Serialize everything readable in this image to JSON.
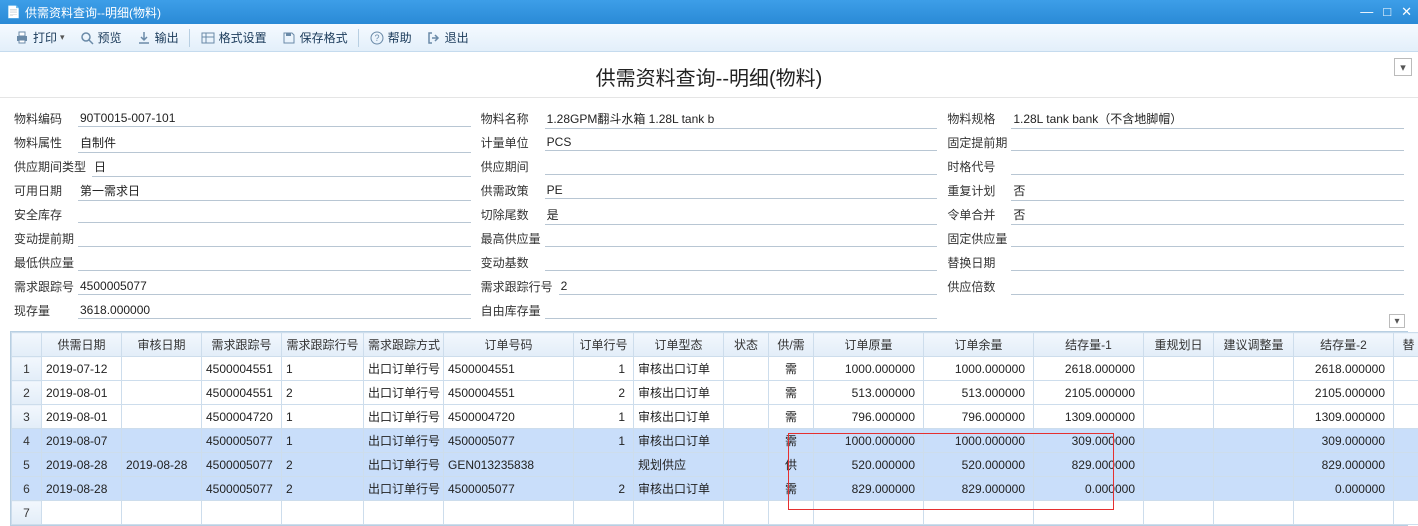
{
  "window": {
    "title": "供需资料查询--明细(物料)"
  },
  "toolbar": {
    "print": "打印",
    "preview": "预览",
    "export": "输出",
    "format": "格式设置",
    "save_format": "保存格式",
    "help": "帮助",
    "exit": "退出"
  },
  "page_title": "供需资料查询--明细(物料)",
  "form": {
    "r1": {
      "a_lbl": "物料编码",
      "a_val": "90T0015-007-101",
      "b_lbl": "物料名称",
      "b_val": "1.28GPM翻斗水箱 1.28L tank b",
      "c_lbl": "物料规格",
      "c_val": "1.28L tank bank（不含地脚帽）"
    },
    "r2": {
      "a_lbl": "物料属性",
      "a_val": "自制件",
      "b_lbl": "计量单位",
      "b_val": "PCS",
      "c_lbl": "固定提前期",
      "c_val": ""
    },
    "r3": {
      "a_lbl": "供应期间类型",
      "a_val": "日",
      "b_lbl": "供应期间",
      "b_val": "",
      "c_lbl": "时格代号",
      "c_val": ""
    },
    "r4": {
      "a_lbl": "可用日期",
      "a_val": "第一需求日",
      "b_lbl": "供需政策",
      "b_val": "PE",
      "c_lbl": "重复计划",
      "c_val": "否"
    },
    "r5": {
      "a_lbl": "安全库存",
      "a_val": "",
      "b_lbl": "切除尾数",
      "b_val": "是",
      "c_lbl": "令单合并",
      "c_val": "否"
    },
    "r6": {
      "a_lbl": "变动提前期",
      "a_val": "",
      "b_lbl": "最高供应量",
      "b_val": "",
      "c_lbl": "固定供应量",
      "c_val": ""
    },
    "r7": {
      "a_lbl": "最低供应量",
      "a_val": "",
      "b_lbl": "变动基数",
      "b_val": "",
      "c_lbl": "替换日期",
      "c_val": ""
    },
    "r8": {
      "a_lbl": "需求跟踪号",
      "a_val": "4500005077",
      "b_lbl": "需求跟踪行号",
      "b_val": "2",
      "c_lbl": "供应倍数",
      "c_val": ""
    },
    "r9": {
      "a_lbl": "现存量",
      "a_val": "3618.000000",
      "b_lbl": "自由库存量",
      "b_val": "",
      "c_lbl": "",
      "c_val": ""
    }
  },
  "columns": {
    "c1": "供需日期",
    "c2": "审核日期",
    "c3": "需求跟踪号",
    "c4": "需求跟踪行号",
    "c5": "需求跟踪方式",
    "c6": "订单号码",
    "c7": "订单行号",
    "c8": "订单型态",
    "c9": "状态",
    "c10": "供/需",
    "c11": "订单原量",
    "c12": "订单余量",
    "c13": "结存量-1",
    "c14": "重规划日",
    "c15": "建议调整量",
    "c16": "结存量-2",
    "c17": "替"
  },
  "rows": [
    {
      "i": "1",
      "d": "2019-07-12",
      "ad": "",
      "tn": "4500004551",
      "tln": "1",
      "tm": "出口订单行号",
      "on": "4500004551",
      "oln": "1",
      "ot": "审核出口订单",
      "st": "",
      "sx": "需",
      "oq": "1000.000000",
      "rq": "1000.000000",
      "b1": "2618.000000",
      "rp": "",
      "adj": "",
      "b2": "2618.000000"
    },
    {
      "i": "2",
      "d": "2019-08-01",
      "ad": "",
      "tn": "4500004551",
      "tln": "2",
      "tm": "出口订单行号",
      "on": "4500004551",
      "oln": "2",
      "ot": "审核出口订单",
      "st": "",
      "sx": "需",
      "oq": "513.000000",
      "rq": "513.000000",
      "b1": "2105.000000",
      "rp": "",
      "adj": "",
      "b2": "2105.000000"
    },
    {
      "i": "3",
      "d": "2019-08-01",
      "ad": "",
      "tn": "4500004720",
      "tln": "1",
      "tm": "出口订单行号",
      "on": "4500004720",
      "oln": "1",
      "ot": "审核出口订单",
      "st": "",
      "sx": "需",
      "oq": "796.000000",
      "rq": "796.000000",
      "b1": "1309.000000",
      "rp": "",
      "adj": "",
      "b2": "1309.000000"
    },
    {
      "i": "4",
      "d": "2019-08-07",
      "ad": "",
      "tn": "4500005077",
      "tln": "1",
      "tm": "出口订单行号",
      "on": "4500005077",
      "oln": "1",
      "ot": "审核出口订单",
      "st": "",
      "sx": "需",
      "oq": "1000.000000",
      "rq": "1000.000000",
      "b1": "309.000000",
      "rp": "",
      "adj": "",
      "b2": "309.000000"
    },
    {
      "i": "5",
      "d": "2019-08-28",
      "ad": "2019-08-28",
      "tn": "4500005077",
      "tln": "2",
      "tm": "出口订单行号",
      "on": "GEN013235838",
      "oln": "",
      "ot": "规划供应",
      "st": "",
      "sx": "供",
      "oq": "520.000000",
      "rq": "520.000000",
      "b1": "829.000000",
      "rp": "",
      "adj": "",
      "b2": "829.000000"
    },
    {
      "i": "6",
      "d": "2019-08-28",
      "ad": "",
      "tn": "4500005077",
      "tln": "2",
      "tm": "出口订单行号",
      "on": "4500005077",
      "oln": "2",
      "ot": "审核出口订单",
      "st": "",
      "sx": "需",
      "oq": "829.000000",
      "rq": "829.000000",
      "b1": "0.000000",
      "rp": "",
      "adj": "",
      "b2": "0.000000"
    },
    {
      "i": "7",
      "d": "",
      "ad": "",
      "tn": "",
      "tln": "",
      "tm": "",
      "on": "",
      "oln": "",
      "ot": "",
      "st": "",
      "sx": "",
      "oq": "",
      "rq": "",
      "b1": "",
      "rp": "",
      "adj": "",
      "b2": ""
    }
  ],
  "chart_data": {
    "type": "table",
    "columns": [
      "供需日期",
      "审核日期",
      "需求跟踪号",
      "需求跟踪行号",
      "需求跟踪方式",
      "订单号码",
      "订单行号",
      "订单型态",
      "状态",
      "供/需",
      "订单原量",
      "订单余量",
      "结存量-1",
      "重规划日",
      "建议调整量",
      "结存量-2"
    ],
    "rows": [
      [
        "2019-07-12",
        "",
        "4500004551",
        "1",
        "出口订单行号",
        "4500004551",
        "1",
        "审核出口订单",
        "",
        "需",
        1000.0,
        1000.0,
        2618.0,
        "",
        "",
        2618.0
      ],
      [
        "2019-08-01",
        "",
        "4500004551",
        "2",
        "出口订单行号",
        "4500004551",
        "2",
        "审核出口订单",
        "",
        "需",
        513.0,
        513.0,
        2105.0,
        "",
        "",
        2105.0
      ],
      [
        "2019-08-01",
        "",
        "4500004720",
        "1",
        "出口订单行号",
        "4500004720",
        "1",
        "审核出口订单",
        "",
        "需",
        796.0,
        796.0,
        1309.0,
        "",
        "",
        1309.0
      ],
      [
        "2019-08-07",
        "",
        "4500005077",
        "1",
        "出口订单行号",
        "4500005077",
        "1",
        "审核出口订单",
        "",
        "需",
        1000.0,
        1000.0,
        309.0,
        "",
        "",
        309.0
      ],
      [
        "2019-08-28",
        "2019-08-28",
        "4500005077",
        "2",
        "出口订单行号",
        "GEN013235838",
        "",
        "规划供应",
        "",
        "供",
        520.0,
        520.0,
        829.0,
        "",
        "",
        829.0
      ],
      [
        "2019-08-28",
        "",
        "4500005077",
        "2",
        "出口订单行号",
        "4500005077",
        "2",
        "审核出口订单",
        "",
        "需",
        829.0,
        829.0,
        0.0,
        "",
        "",
        0.0
      ]
    ]
  }
}
